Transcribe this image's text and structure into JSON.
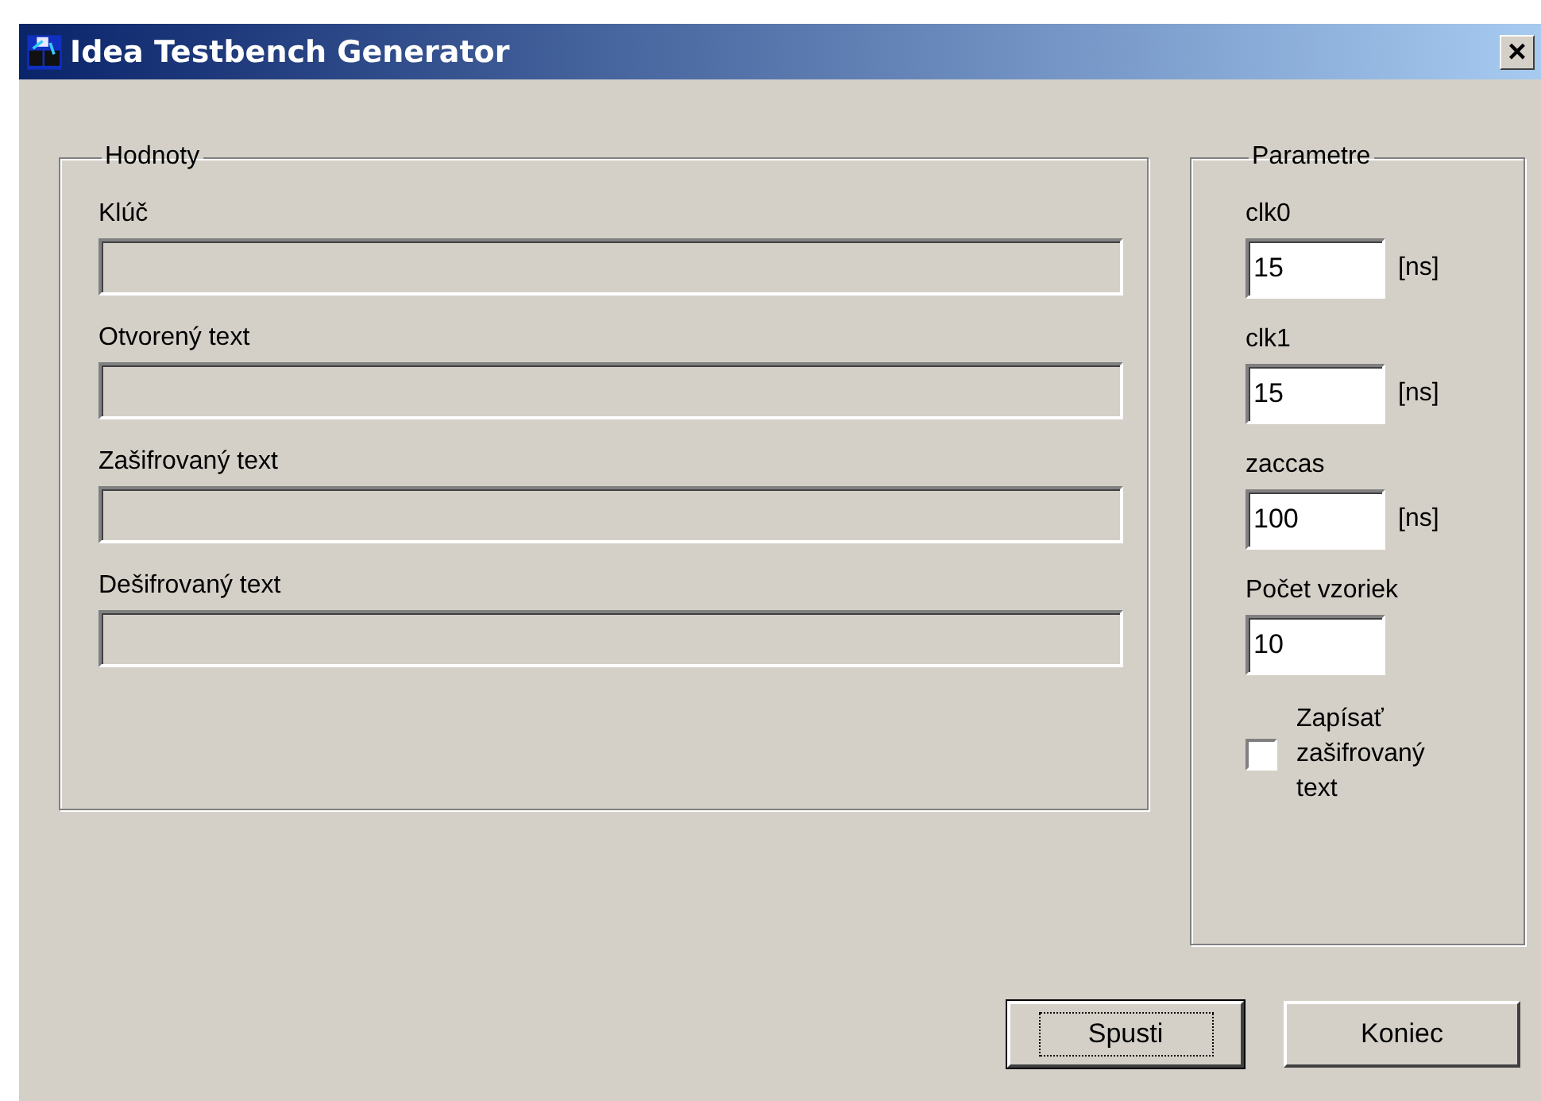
{
  "window": {
    "title": "Idea Testbench Generator",
    "close": "×"
  },
  "values_group": {
    "title": "Hodnoty",
    "fields": [
      {
        "label": "Klúč",
        "disabled": true
      },
      {
        "label": "Otvorený text",
        "disabled": true
      },
      {
        "label": "Zašifrovaný text",
        "disabled": true
      },
      {
        "label": "Dešifrovaný text",
        "disabled": true
      }
    ]
  },
  "params_group": {
    "title": "Parametre",
    "fields": [
      {
        "label": "clk0",
        "value": "15",
        "unit": "[ns]"
      },
      {
        "label": "clk1",
        "value": "15",
        "unit": "[ns]"
      },
      {
        "label": "zaccas",
        "value": "100",
        "unit": "[ns]"
      },
      {
        "label": "Počet vzoriek",
        "value": "10"
      }
    ],
    "checkbox": {
      "label": "Zapísať zašifrovaný text",
      "checked": false
    }
  },
  "buttons": [
    {
      "label": "Spusti",
      "focused": true
    },
    {
      "label": "Koniec",
      "focused": false
    }
  ]
}
